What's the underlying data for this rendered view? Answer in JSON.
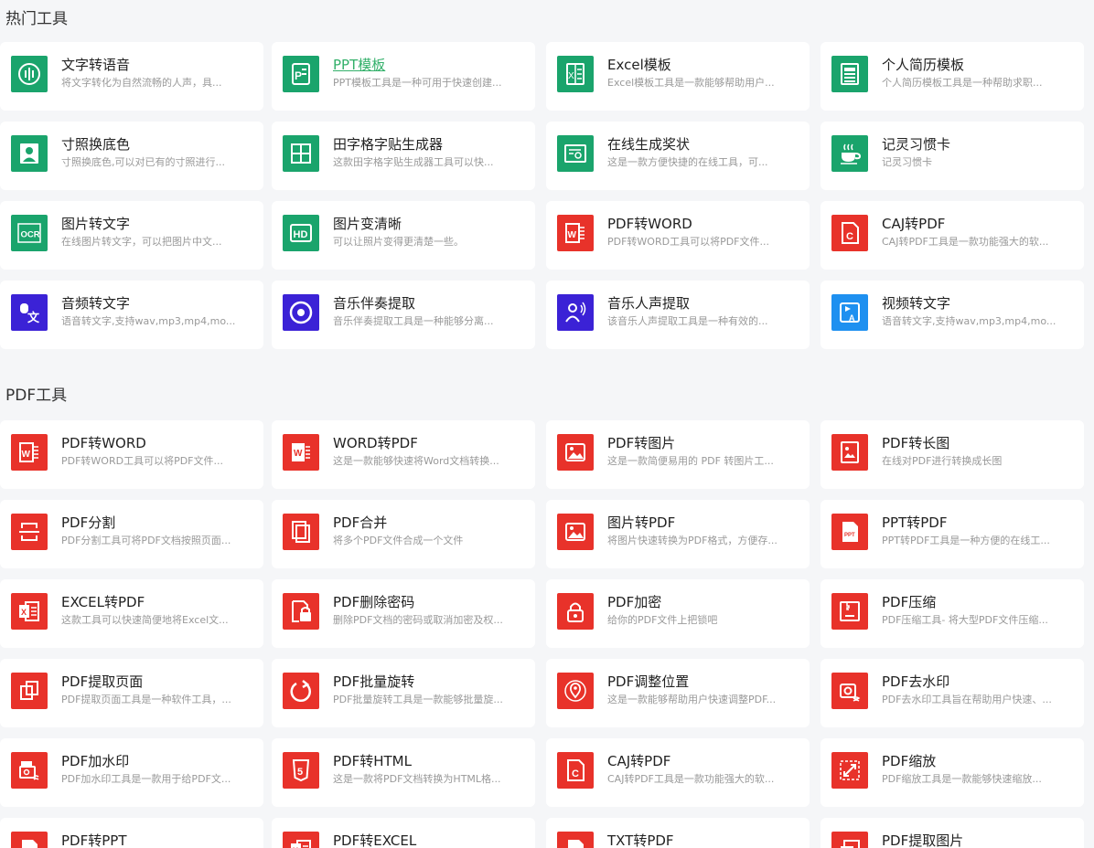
{
  "colors": {
    "green": "#1aa46c",
    "red": "#e8322a",
    "indigo": "#3b22d6",
    "blue": "#1e90f0",
    "link": "#33b06a"
  },
  "sections": [
    {
      "title": "热门工具",
      "items": [
        {
          "title": "文字转语音",
          "desc": "将文字转化为自然流畅的人声，具...",
          "icon": "voice-icon",
          "color": "green"
        },
        {
          "title": "PPT模板",
          "desc": "PPT模板工具是一种可用于快速创建...",
          "icon": "ppt-icon",
          "color": "green",
          "link": true
        },
        {
          "title": "Excel模板",
          "desc": "Excel模板工具是一款能够帮助用户...",
          "icon": "excel-icon",
          "color": "green"
        },
        {
          "title": "个人简历模板",
          "desc": "个人简历模板工具是一种帮助求职...",
          "icon": "resume-icon",
          "color": "green"
        },
        {
          "title": "寸照换底色",
          "desc": "寸照换底色,可以对已有的寸照进行...",
          "icon": "portrait-icon",
          "color": "green"
        },
        {
          "title": "田字格字贴生成器",
          "desc": "这款田字格字贴生成器工具可以快...",
          "icon": "grid-icon",
          "color": "green"
        },
        {
          "title": "在线生成奖状",
          "desc": "这是一款方便快捷的在线工具，可...",
          "icon": "certificate-icon",
          "color": "green"
        },
        {
          "title": "记灵习惯卡",
          "desc": "记灵习惯卡",
          "icon": "cup-icon",
          "color": "green"
        },
        {
          "title": "图片转文字",
          "desc": "在线图片转文字，可以把图片中文...",
          "icon": "ocr-icon",
          "color": "green"
        },
        {
          "title": "图片变清晰",
          "desc": "可以让照片变得更清楚一些。",
          "icon": "hd-icon",
          "color": "green"
        },
        {
          "title": "PDF转WORD",
          "desc": "PDF转WORD工具可以将PDF文件...",
          "icon": "word-icon",
          "color": "red"
        },
        {
          "title": "CAJ转PDF",
          "desc": "CAJ转PDF工具是一款功能强大的软...",
          "icon": "caj-icon",
          "color": "red"
        },
        {
          "title": "音频转文字",
          "desc": "语音转文字,支持wav,mp3,mp4,mo...",
          "icon": "audio-text-icon",
          "color": "indigo"
        },
        {
          "title": "音乐伴奏提取",
          "desc": "音乐伴奏提取工具是一种能够分离...",
          "icon": "music-disc-icon",
          "color": "indigo"
        },
        {
          "title": "音乐人声提取",
          "desc": "该音乐人声提取工具是一种有效的...",
          "icon": "vocal-icon",
          "color": "indigo"
        },
        {
          "title": "视频转文字",
          "desc": "语音转文字,支持wav,mp3,mp4,mo...",
          "icon": "video-text-icon",
          "color": "blue"
        }
      ]
    },
    {
      "title": "PDF工具",
      "items": [
        {
          "title": "PDF转WORD",
          "desc": "PDF转WORD工具可以将PDF文件...",
          "icon": "word-icon",
          "color": "red"
        },
        {
          "title": "WORD转PDF",
          "desc": "这是一款能够快速将Word文档转换...",
          "icon": "word-doc-icon",
          "color": "red"
        },
        {
          "title": "PDF转图片",
          "desc": "这是一款简便易用的 PDF 转图片工...",
          "icon": "image-icon",
          "color": "red"
        },
        {
          "title": "PDF转长图",
          "desc": "在线对PDF进行转换成长图",
          "icon": "long-image-icon",
          "color": "red"
        },
        {
          "title": "PDF分割",
          "desc": "PDF分割工具可将PDF文档按照页面...",
          "icon": "split-icon",
          "color": "red"
        },
        {
          "title": "PDF合并",
          "desc": "将多个PDF文件合成一个文件",
          "icon": "merge-icon",
          "color": "red"
        },
        {
          "title": "图片转PDF",
          "desc": "将图片快速转换为PDF格式，方便存...",
          "icon": "image-icon",
          "color": "red"
        },
        {
          "title": "PPT转PDF",
          "desc": "PPT转PDF工具是一种方便的在线工...",
          "icon": "ppt-file-icon",
          "color": "red"
        },
        {
          "title": "EXCEL转PDF",
          "desc": "这款工具可以快速简便地将Excel文...",
          "icon": "excel-doc-icon",
          "color": "red"
        },
        {
          "title": "PDF删除密码",
          "desc": "删除PDF文档的密码或取消加密及权...",
          "icon": "unlock-icon",
          "color": "red"
        },
        {
          "title": "PDF加密",
          "desc": "给你的PDF文件上把锁吧",
          "icon": "lock-icon",
          "color": "red"
        },
        {
          "title": "PDF压缩",
          "desc": "PDF压缩工具- 将大型PDF文件压缩...",
          "icon": "compress-icon",
          "color": "red"
        },
        {
          "title": "PDF提取页面",
          "desc": "PDF提取页面工具是一种软件工具，...",
          "icon": "extract-page-icon",
          "color": "red"
        },
        {
          "title": "PDF批量旋转",
          "desc": "PDF批量旋转工具是一款能够批量旋...",
          "icon": "rotate-icon",
          "color": "red"
        },
        {
          "title": "PDF调整位置",
          "desc": "这是一款能够帮助用户快速调整PDF...",
          "icon": "location-icon",
          "color": "red"
        },
        {
          "title": "PDF去水印",
          "desc": "PDF去水印工具旨在帮助用户快速、...",
          "icon": "remove-watermark-icon",
          "color": "red"
        },
        {
          "title": "PDF加水印",
          "desc": "PDF加水印工具是一款用于给PDF文...",
          "icon": "add-watermark-icon",
          "color": "red"
        },
        {
          "title": "PDF转HTML",
          "desc": "这是一款将PDF文档转换为HTML格...",
          "icon": "html5-icon",
          "color": "red"
        },
        {
          "title": "CAJ转PDF",
          "desc": "CAJ转PDF工具是一款功能强大的软...",
          "icon": "caj-icon",
          "color": "red"
        },
        {
          "title": "PDF缩放",
          "desc": "PDF缩放工具是一款能够快速缩放...",
          "icon": "zoom-icon",
          "color": "red"
        },
        {
          "title": "PDF转PPT",
          "desc": "",
          "icon": "ppt-file-icon",
          "color": "red"
        },
        {
          "title": "PDF转EXCEL",
          "desc": "",
          "icon": "excel-doc-icon",
          "color": "red"
        },
        {
          "title": "TXT转PDF",
          "desc": "",
          "icon": "txt-icon",
          "color": "red"
        },
        {
          "title": "PDF提取图片",
          "desc": "",
          "icon": "extract-image-icon",
          "color": "red"
        }
      ]
    }
  ]
}
